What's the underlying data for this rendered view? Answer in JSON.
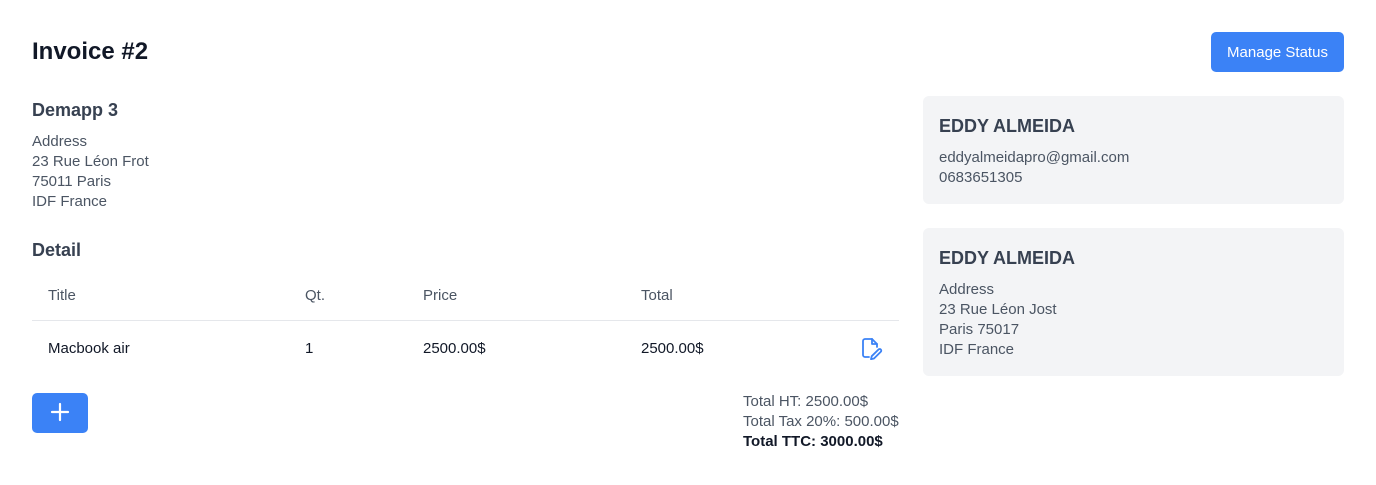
{
  "header": {
    "title": "Invoice #2",
    "manage_status_label": "Manage Status"
  },
  "company": {
    "name": "Demapp 3",
    "address_lines": [
      "Address",
      "23 Rue Léon Frot",
      "75011 Paris",
      "IDF France"
    ]
  },
  "detail": {
    "heading": "Detail",
    "columns": [
      "Title",
      "Qt.",
      "Price",
      "Total"
    ],
    "rows": [
      {
        "title": "Macbook air",
        "qty": "1",
        "price": "2500.00$",
        "total": "2500.00$",
        "action_icon": "edit-document-icon"
      }
    ],
    "add_icon": "plus-icon"
  },
  "totals": {
    "ht": "Total HT: 2500.00$",
    "tax": "Total Tax 20%: 500.00$",
    "ttc": "Total TTC: 3000.00$"
  },
  "client_contact": {
    "name": "EDDY ALMEIDA",
    "email": "eddyalmeidapro@gmail.com",
    "phone": "0683651305"
  },
  "client_address": {
    "name": "EDDY ALMEIDA",
    "lines": [
      "Address",
      "23 Rue Léon Jost",
      "Paris 75017",
      "IDF France"
    ]
  },
  "colors": {
    "accent": "#3b82f6",
    "card_bg": "#f3f4f6",
    "heading": "#374151",
    "muted": "#4b5563"
  }
}
